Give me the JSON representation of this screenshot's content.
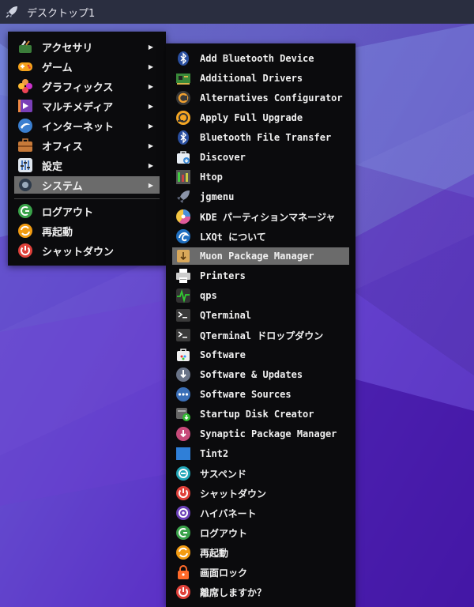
{
  "taskbar": {
    "desktop_label": "デスクトップ1",
    "launcher_icon": "rocket-icon"
  },
  "main_menu": {
    "categories": [
      {
        "label": "アクセサリ",
        "icon": "accessories-icon"
      },
      {
        "label": "ゲーム",
        "icon": "games-icon"
      },
      {
        "label": "グラフィックス",
        "icon": "graphics-icon"
      },
      {
        "label": "マルチメディア",
        "icon": "multimedia-icon"
      },
      {
        "label": "インターネット",
        "icon": "internet-icon"
      },
      {
        "label": "オフィス",
        "icon": "office-icon"
      },
      {
        "label": "設定",
        "icon": "settings-icon"
      },
      {
        "label": "システム",
        "icon": "system-icon",
        "highlighted": true
      }
    ],
    "actions": [
      {
        "label": "ログアウト",
        "icon": "logout-icon"
      },
      {
        "label": "再起動",
        "icon": "reboot-icon"
      },
      {
        "label": "シャットダウン",
        "icon": "shutdown-icon"
      }
    ],
    "submenu_arrow": "▶"
  },
  "system_submenu": {
    "items": [
      {
        "label": "Add Bluetooth Device",
        "icon": "bluetooth-icon"
      },
      {
        "label": "Additional Drivers",
        "icon": "drivers-card-icon"
      },
      {
        "label": "Alternatives Configurator",
        "icon": "alternatives-icon"
      },
      {
        "label": "Apply Full Upgrade",
        "icon": "upgrade-icon"
      },
      {
        "label": "Bluetooth File Transfer",
        "icon": "bluetooth-icon"
      },
      {
        "label": "Discover",
        "icon": "discover-icon"
      },
      {
        "label": "Htop",
        "icon": "htop-icon"
      },
      {
        "label": "jgmenu",
        "icon": "rocket-icon"
      },
      {
        "label": "KDE パーティションマネージャ",
        "icon": "partition-manager-icon"
      },
      {
        "label": "LXQt について",
        "icon": "lxqt-icon"
      },
      {
        "label": "Muon Package Manager",
        "icon": "package-icon",
        "highlighted": true
      },
      {
        "label": "Printers",
        "icon": "printer-icon"
      },
      {
        "label": "qps",
        "icon": "qps-icon"
      },
      {
        "label": "QTerminal",
        "icon": "terminal-icon"
      },
      {
        "label": "QTerminal ドロップダウン",
        "icon": "terminal-icon"
      },
      {
        "label": "Software",
        "icon": "software-icon"
      },
      {
        "label": "Software & Updates",
        "icon": "software-updates-icon"
      },
      {
        "label": "Software Sources",
        "icon": "software-sources-icon"
      },
      {
        "label": "Startup Disk Creator",
        "icon": "startup-disk-icon"
      },
      {
        "label": "Synaptic Package Manager",
        "icon": "synaptic-icon"
      },
      {
        "label": "Tint2",
        "icon": "tint2-icon"
      },
      {
        "label": "サスペンド",
        "icon": "suspend-icon"
      },
      {
        "label": "シャットダウン",
        "icon": "shutdown-icon"
      },
      {
        "label": "ハイバネート",
        "icon": "hibernate-icon"
      },
      {
        "label": "ログアウト",
        "icon": "logout-icon"
      },
      {
        "label": "再起動",
        "icon": "reboot-icon"
      },
      {
        "label": "画面ロック",
        "icon": "lock-screen-icon"
      },
      {
        "label": "離席しますか？",
        "icon": "leave-icon"
      }
    ]
  },
  "colors": {
    "menu_bg": "#0b0b0d",
    "highlight": "#6b6b6b",
    "taskbar": "#2a2e40"
  }
}
